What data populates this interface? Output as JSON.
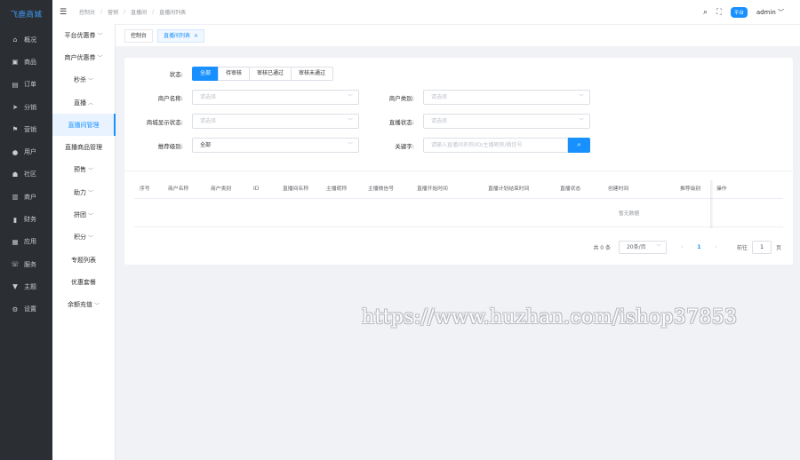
{
  "app": {
    "logo": "飞鹿商城"
  },
  "sidebar": {
    "items": [
      {
        "label": "概况",
        "icon": "home-icon",
        "glyph": "⌂"
      },
      {
        "label": "商品",
        "icon": "bag-icon",
        "glyph": "▣"
      },
      {
        "label": "订单",
        "icon": "order-icon",
        "glyph": "▤"
      },
      {
        "label": "分销",
        "icon": "send-icon",
        "glyph": "➤"
      },
      {
        "label": "营销",
        "icon": "flag-icon",
        "glyph": "⚑"
      },
      {
        "label": "用户",
        "icon": "user-icon",
        "glyph": "●"
      },
      {
        "label": "社区",
        "icon": "community-icon",
        "glyph": "☗"
      },
      {
        "label": "商户",
        "icon": "store-icon",
        "glyph": "▥"
      },
      {
        "label": "财务",
        "icon": "finance-icon",
        "glyph": "▮"
      },
      {
        "label": "应用",
        "icon": "apps-icon",
        "glyph": "▦"
      },
      {
        "label": "服务",
        "icon": "phone-icon",
        "glyph": "☏"
      },
      {
        "label": "主题",
        "icon": "theme-icon",
        "glyph": "▼"
      },
      {
        "label": "设置",
        "icon": "gear-icon",
        "glyph": "⚙"
      }
    ]
  },
  "subnav": {
    "items": [
      {
        "label": "平台优惠券",
        "chev": "﹀"
      },
      {
        "label": "商户优惠券",
        "chev": "﹀"
      },
      {
        "label": "秒杀",
        "chev": "﹀"
      },
      {
        "label": "直播",
        "chev": "︿"
      },
      {
        "label": "直播间管理",
        "chev": ""
      },
      {
        "label": "直播商品管理",
        "chev": ""
      },
      {
        "label": "预售",
        "chev": "﹀"
      },
      {
        "label": "助力",
        "chev": "﹀"
      },
      {
        "label": "拼团",
        "chev": "﹀"
      },
      {
        "label": "积分",
        "chev": "﹀"
      },
      {
        "label": "专题列表",
        "chev": ""
      },
      {
        "label": "优惠套餐",
        "chev": ""
      },
      {
        "label": "余额充值",
        "chev": "﹀"
      }
    ]
  },
  "header": {
    "breadcrumb": [
      "控制台",
      "营销",
      "直播间",
      "直播间列表"
    ],
    "badge": "平台",
    "user": "admin",
    "user_chevron": "﹀"
  },
  "tags": {
    "console": "控制台",
    "current": "直播间列表",
    "close": "×"
  },
  "filters": {
    "status_label": "状态:",
    "status_options": [
      "全部",
      "待审核",
      "审核已通过",
      "审核未通过"
    ],
    "merchant_name_label": "商户名称:",
    "merchant_name_placeholder": "请选择",
    "merchant_type_label": "商户类别:",
    "merchant_type_placeholder": "请选择",
    "display_status_label": "商城显示状态:",
    "display_status_placeholder": "请选择",
    "live_status_label": "直播状态:",
    "live_status_placeholder": "请选择",
    "sort_label": "推荐级别:",
    "sort_value": "全部",
    "keyword_label": "关键字:",
    "keyword_placeholder": "请输入直播间名称/ID/主播昵称/微信号"
  },
  "table": {
    "columns": [
      "序号",
      "商户名称",
      "商户类别",
      "ID",
      "直播间名称",
      "主播昵称",
      "主播微信号",
      "直播开始时间",
      "直播计划结束时间",
      "直播状态",
      "创建时间",
      "推荐级别",
      "操作"
    ],
    "empty_text": "暂无数据"
  },
  "pagination": {
    "total": "共 0 条",
    "page_size": "20条/页",
    "prev": "‹",
    "current_page": "1",
    "next": "›",
    "goto_label": "前往",
    "goto_value": "1",
    "page_unit": "页"
  },
  "watermark": "https://www.huzhan.com/ishop37853",
  "colors": {
    "accent": "#1890ff",
    "sidebar_bg": "#2b2f33",
    "page_bg": "#f0f2f5"
  }
}
